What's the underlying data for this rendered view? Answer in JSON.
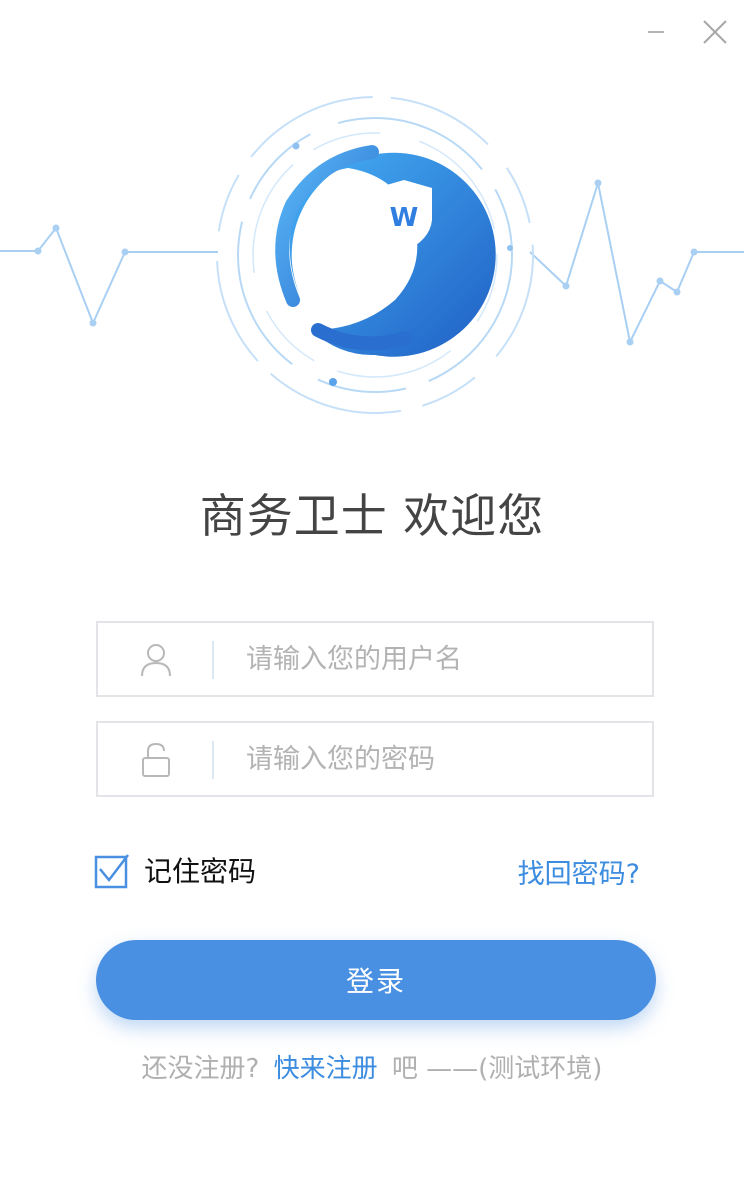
{
  "window": {
    "minimize_icon": "minus-icon",
    "close_icon": "close-icon"
  },
  "brand": {
    "logo_letter": "W",
    "welcome_text": "商务卫士 欢迎您",
    "accent_color": "#4a90e2",
    "link_color": "#3c8ce0"
  },
  "form": {
    "username": {
      "icon": "user-icon",
      "value": "",
      "placeholder": "请输入您的用户名"
    },
    "password": {
      "icon": "lock-icon",
      "value": "",
      "placeholder": "请输入您的密码"
    },
    "remember": {
      "label": "记住密码",
      "checked": true
    },
    "forgot_label": "找回密码?",
    "login_label": "登录"
  },
  "footer": {
    "prefix": "还没注册?",
    "link": "快来注册",
    "suffix": "吧 ——(测试环境)"
  }
}
